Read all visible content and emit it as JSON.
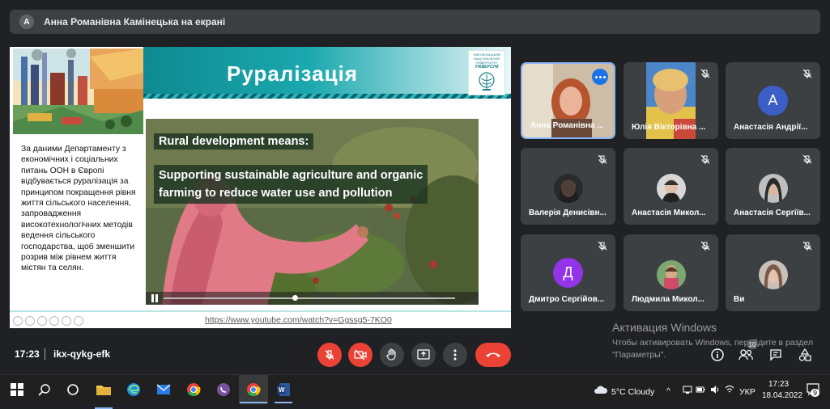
{
  "banner": {
    "avatar_letter": "А",
    "text": "Анна Романівна Камінецька на екрані"
  },
  "slide": {
    "title": "Руралізація",
    "logo_line1": "ХМЕЛЬНИЦЬКИЙ НАЦІОНАЛЬНИЙ УНІВЕРСИТЕТ",
    "logo_line2": "УНІВЕРСУМ",
    "body": "За даними Департаменту з економічних і соціальних питань ООН в Європі відбувається руралізація за принципом покращення рівня життя сільського населення, запровадження високотехнологічних методів ведення сільського господарства, щоб зменшити розрив між рівнем життя містян та селян.",
    "video_caption1": "Rural development means:",
    "video_caption2_line1": "Supporting sustainable agriculture and organic",
    "video_caption2_line2": "farming to reduce water use and pollution",
    "video_progress": 0.45,
    "link": "https://www.youtube.com/watch?v=Ggssg5-7KO0"
  },
  "participants": [
    {
      "name": "Анна Романівна ...",
      "type": "video"
    },
    {
      "name": "Юлія Вікторівна ...",
      "type": "video"
    },
    {
      "name": "Анастасія Андрії...",
      "type": "letter",
      "letter": "А",
      "color": "#3c5ec7"
    },
    {
      "name": "Валерія Денисівн...",
      "type": "photo"
    },
    {
      "name": "Анастасія Микол...",
      "type": "photo"
    },
    {
      "name": "Анастасія Сергіїв...",
      "type": "photo"
    },
    {
      "name": "Дмитро Сергійов...",
      "type": "letter",
      "letter": "Д",
      "color": "#9334e6"
    },
    {
      "name": "Людмила Микол...",
      "type": "photo"
    },
    {
      "name": "Ви",
      "type": "photo"
    }
  ],
  "watermark": {
    "title": "Активация Windows",
    "line": "Чтобы активировать Windows, перейдите в раздел \"Параметры\"."
  },
  "meeting": {
    "time": "17:23",
    "code": "ikx-qykg-efk",
    "participants_count": "10"
  },
  "taskbar": {
    "weather": "5°C  Cloudy",
    "lang": "УКР",
    "clock_time": "17:23",
    "clock_date": "18.04.2022",
    "notifications": "9"
  },
  "colors": {
    "bg": "#202124",
    "tile": "#3c4043",
    "red": "#ea4335",
    "accent": "#8ab4f8"
  }
}
